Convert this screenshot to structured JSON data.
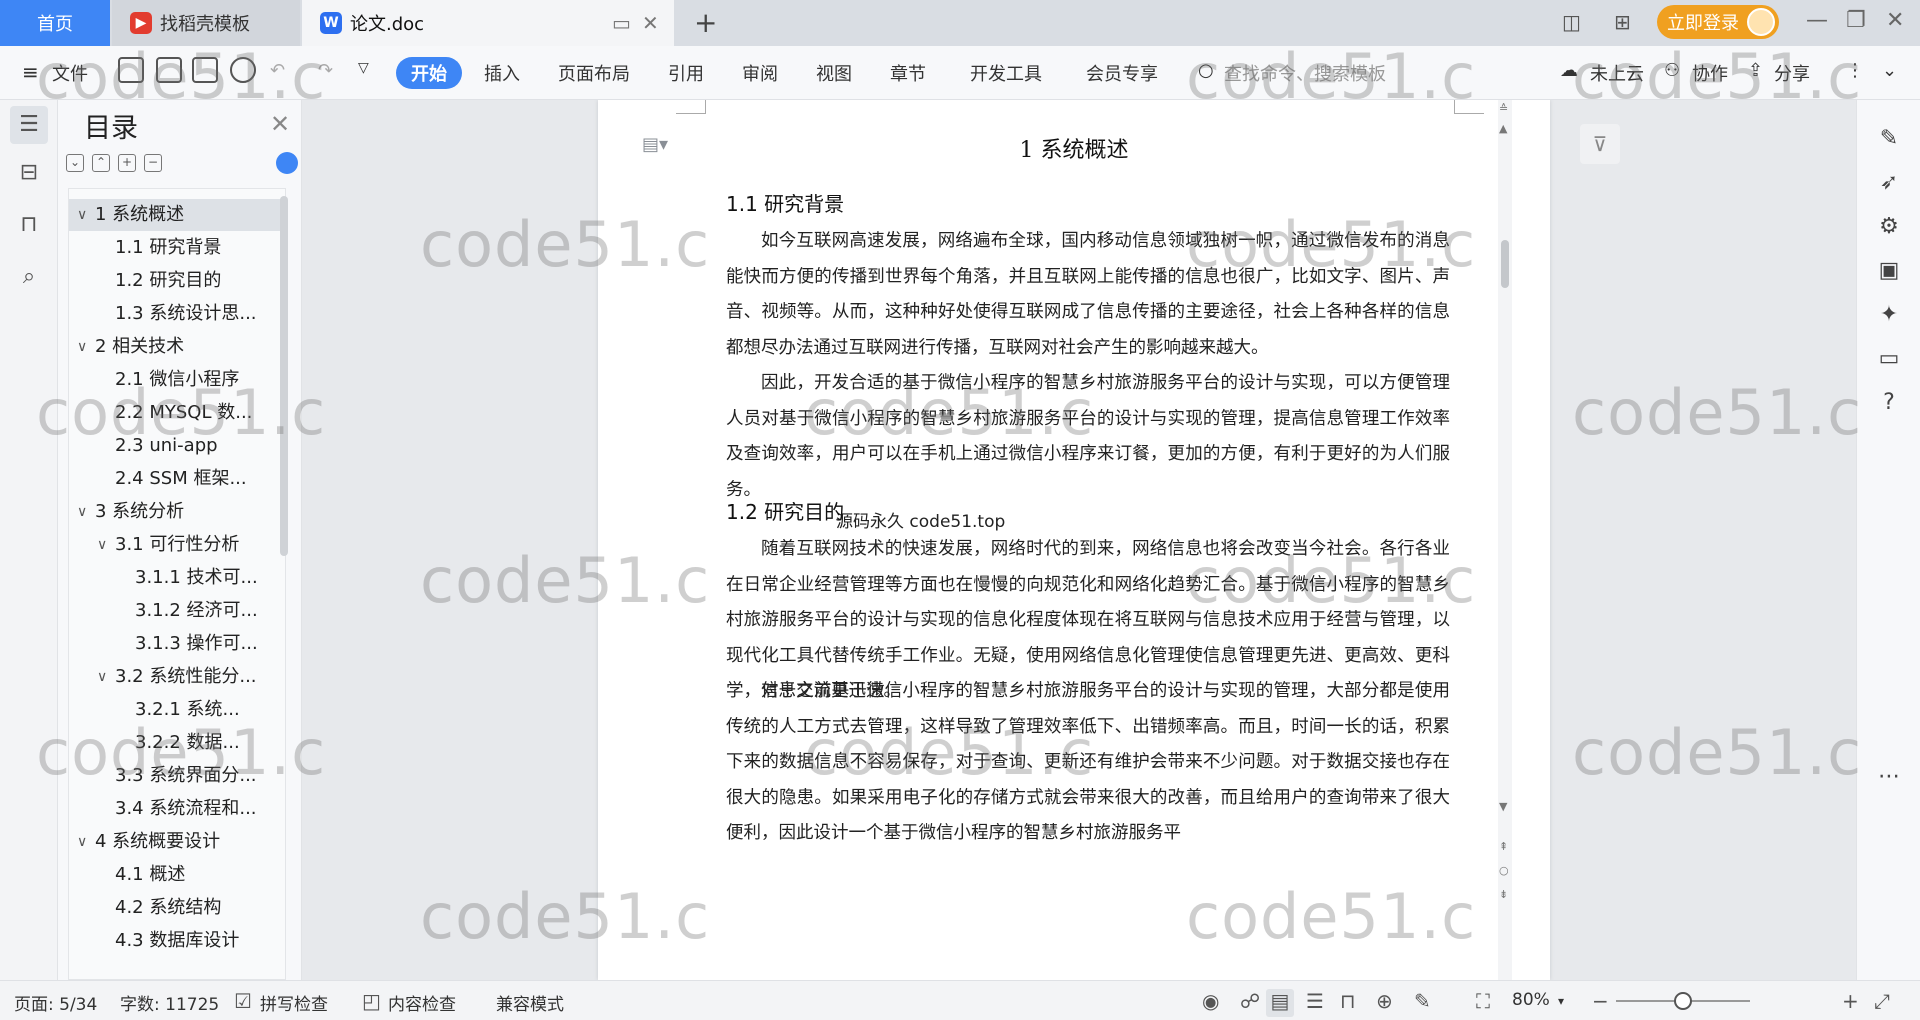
{
  "tabs": {
    "home": "首页",
    "daoke": "找稻壳模板",
    "doc": "论文.doc",
    "login": "立即登录"
  },
  "toolbar": {
    "file": "文件",
    "menus": [
      "开始",
      "插入",
      "页面布局",
      "引用",
      "审阅",
      "视图",
      "章节",
      "开发工具",
      "会员专享"
    ],
    "search_placeholder": "查找命令、搜索模板",
    "cloud": "未上云",
    "collab": "协作",
    "share": "分享"
  },
  "toc": {
    "title": "目录",
    "items": [
      {
        "label": "1 系统概述",
        "level": 0,
        "arrow": "∨",
        "selected": true
      },
      {
        "label": "1.1  研究背景",
        "level": 1
      },
      {
        "label": "1.2 研究目的",
        "level": 1
      },
      {
        "label": "1.3 系统设计思...",
        "level": 1
      },
      {
        "label": "2 相关技术",
        "level": 0,
        "arrow": "∨"
      },
      {
        "label": "2.1 微信小程序",
        "level": 1
      },
      {
        "label": "2.2 MYSQL 数...",
        "level": 1
      },
      {
        "label": "2.3 uni-app",
        "level": 1
      },
      {
        "label": "2.4 SSM 框架...",
        "level": 1
      },
      {
        "label": "3 系统分析",
        "level": 0,
        "arrow": "∨"
      },
      {
        "label": "3.1 可行性分析",
        "level": 1,
        "arrow": "∨"
      },
      {
        "label": "3.1.1 技术可...",
        "level": 2
      },
      {
        "label": "3.1.2 经济可...",
        "level": 2
      },
      {
        "label": "3.1.3 操作可...",
        "level": 2
      },
      {
        "label": "3.2 系统性能分...",
        "level": 1,
        "arrow": "∨"
      },
      {
        "label": "3.2.1  系统...",
        "level": 2
      },
      {
        "label": "3.2.2  数据...",
        "level": 2
      },
      {
        "label": "3.3 系统界面分...",
        "level": 1
      },
      {
        "label": "3.4 系统流程和...",
        "level": 1
      },
      {
        "label": "4 系统概要设计",
        "level": 0,
        "arrow": "∨"
      },
      {
        "label": "4.1 概述",
        "level": 1
      },
      {
        "label": "4.2 系统结构",
        "level": 1
      },
      {
        "label": "4.3 数据库设计",
        "level": 1
      }
    ]
  },
  "doc": {
    "title": "1 系统概述",
    "h_bg": "1.1  研究背景",
    "p1": "如今互联网高速发展，网络遍布全球，国内移动信息领域独树一帜，通过微信发布的消息能快而方便的传播到世界每个角落，并且互联网上能传播的信息也很广，比如文字、图片、声音、视频等。从而，这种种好处使得互联网成了信息传播的主要途径，社会上各种各样的信息都想尽办法通过互联网进行传播，互联网对社会产生的影响越来越大。",
    "p2": "因此，开发合适的基于微信小程序的智慧乡村旅游服务平台的设计与实现，可以方便管理人员对基于微信小程序的智慧乡村旅游服务平台的设计与实现的管理，提高信息管理工作效率及查询效率，用户可以在手机上通过微信小程序来订餐，更加的方便，有利于更好的为人们服务。",
    "overlay": "源码永久 code51.top",
    "h_goal": "1.2 研究目的",
    "p3": "随着互联网技术的快速发展，网络时代的到来，网络信息也将会改变当今社会。各行各业在日常企业经营管理等方面也在慢慢的向规范化和网络化趋势汇合。基于微信小程序的智慧乡村旅游服务平台的设计与实现的信息化程度体现在将互联网与信息技术应用于经营与管理，以现代化工具代替传统手工作业。无疑，使用网络信息化管理使信息管理更先进、更高效、更科学，信息交流更迅速。",
    "p4": "对于之前基于微信小程序的智慧乡村旅游服务平台的设计与实现的管理，大部分都是使用传统的人工方式去管理，这样导致了管理效率低下、出错频率高。而且，时间一长的话，积累下来的数据信息不容易保存，对于查询、更新还有维护会带来不少问题。对于数据交接也存在很大的隐患。如果采用电子化的存储方式就会带来很大的改善，而且给用户的查询带来了很大便利，因此设计一个基于微信小程序的智慧乡村旅游服务平"
  },
  "status": {
    "page": "页面: 5/34",
    "words": "字数: 11725",
    "spell": "拼写检查",
    "content_check": "内容检查",
    "compat": "兼容模式",
    "zoom": "80%",
    "zoom_level": 0.5
  },
  "watermark": "code51.c",
  "colors": {
    "accent": "#3e86f5",
    "login": "#f0a020"
  }
}
